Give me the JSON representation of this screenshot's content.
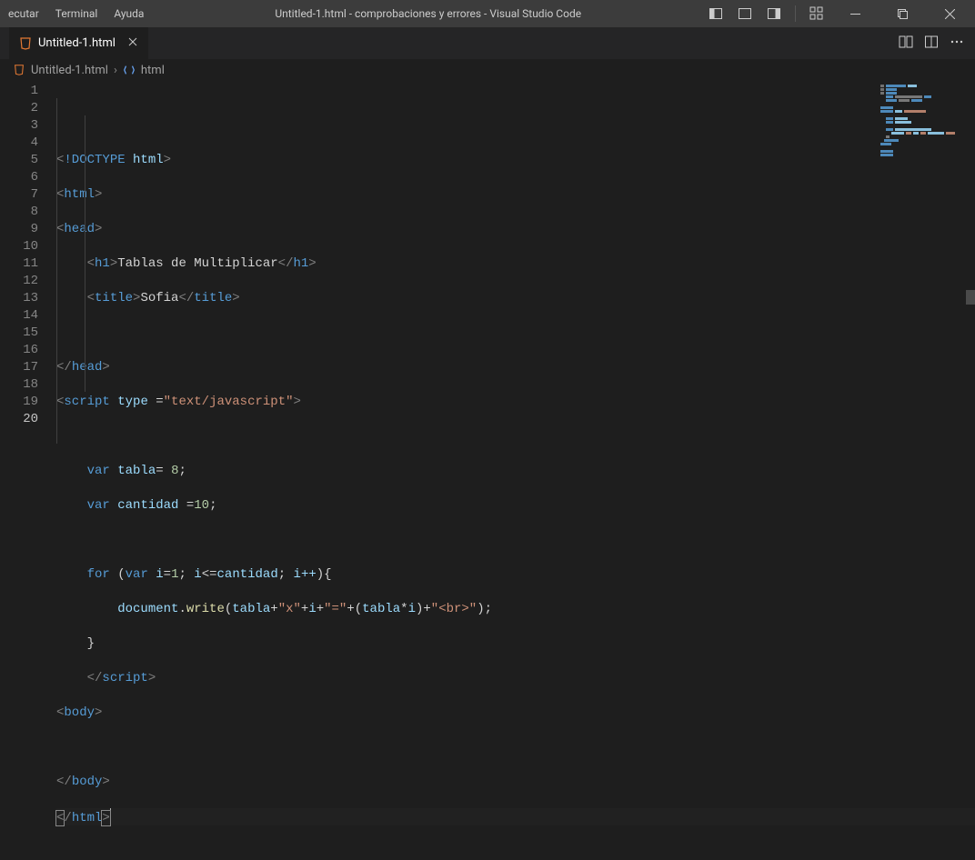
{
  "menubar": {
    "items": [
      "ecutar",
      "Terminal",
      "Ayuda"
    ]
  },
  "window_title": "Untitled-1.html - comprobaciones y errores - Visual Studio Code",
  "tab": {
    "filename": "Untitled-1.html"
  },
  "breadcrumb": {
    "file": "Untitled-1.html",
    "symbol": "html"
  },
  "lines": {
    "count": 20,
    "active": 20,
    "l1": {
      "doctype": "!DOCTYPE",
      "html": "html"
    },
    "l2": {
      "tag": "html"
    },
    "l3": {
      "tag": "head"
    },
    "l4": {
      "tag": "h1",
      "text": "Tablas de Multiplicar"
    },
    "l5": {
      "tag": "title",
      "text": "Sofia"
    },
    "l7": {
      "tag": "head"
    },
    "l8": {
      "tag": "script",
      "attr": "type",
      "val": "\"text/javascript\""
    },
    "l10": {
      "kw": "var",
      "v": "tabla",
      "n": "8"
    },
    "l11": {
      "kw": "var",
      "v": "cantidad",
      "n": "10"
    },
    "l13": {
      "for": "for",
      "varkw": "var",
      "v": "i",
      "one": "1",
      "cant": "cantidad",
      "inc": "i++"
    },
    "l14": {
      "obj": "document",
      "fn": "write",
      "v": "tabla",
      "sx": "\"x\"",
      "i": "i",
      "se": "\"=\"",
      "br": "\"<br>\""
    },
    "l16": {
      "tag": "script"
    },
    "l17": {
      "tag": "body"
    },
    "l19": {
      "tag": "body"
    },
    "l20": {
      "tag": "html"
    }
  }
}
